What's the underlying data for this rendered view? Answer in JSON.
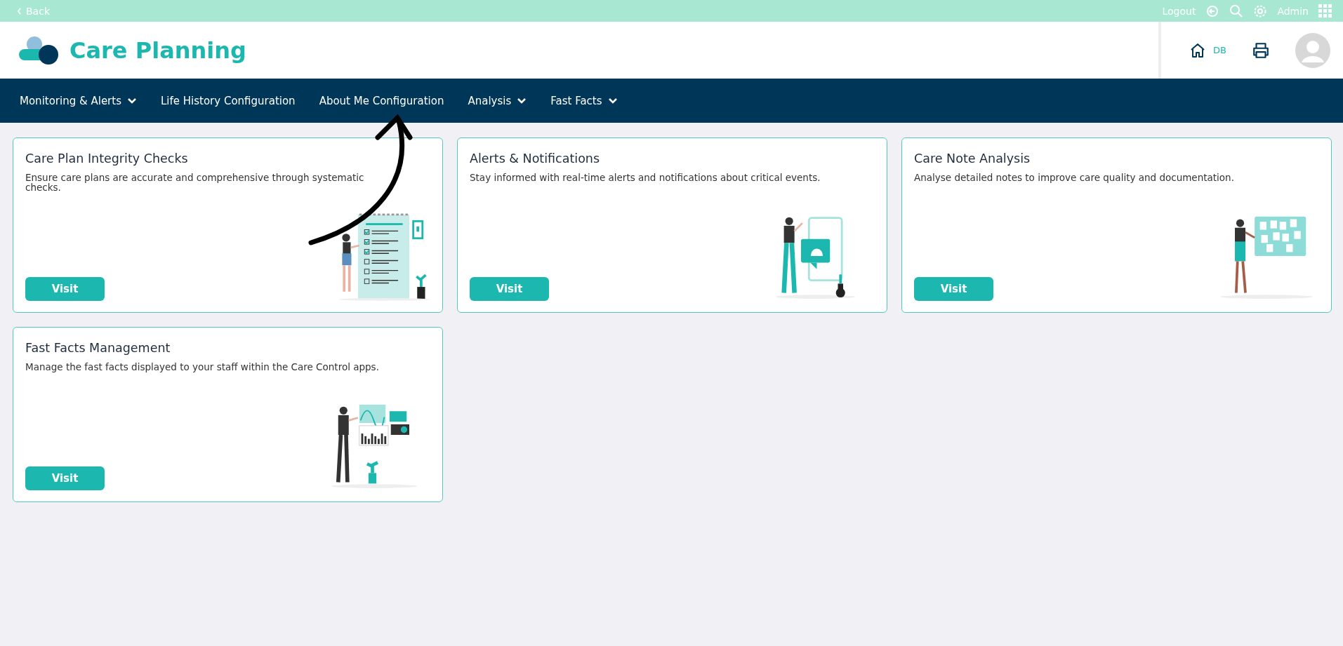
{
  "top_bar": {
    "back": "Back",
    "logout": "Logout",
    "user": "Admin"
  },
  "header": {
    "app_title": "Care Planning",
    "home_label": "DB"
  },
  "nav": [
    {
      "label": "Monitoring & Alerts",
      "dropdown": true
    },
    {
      "label": "Life History Configuration",
      "dropdown": false
    },
    {
      "label": "About Me Configuration",
      "dropdown": false
    },
    {
      "label": "Analysis",
      "dropdown": true
    },
    {
      "label": "Fast Facts",
      "dropdown": true
    }
  ],
  "cards": [
    {
      "title": "Care Plan Integrity Checks",
      "description": "Ensure care plans are accurate and comprehensive through systematic checks.",
      "button": "Visit",
      "kind": "checklist"
    },
    {
      "title": "Alerts & Notifications",
      "description": "Stay informed with real-time alerts and notifications about critical events.",
      "button": "Visit",
      "kind": "alerts"
    },
    {
      "title": "Care Note Analysis",
      "description": "Analyse detailed notes to improve care quality and documentation.",
      "button": "Visit",
      "kind": "board"
    },
    {
      "title": "Fast Facts Management",
      "description": "Manage the fast facts displayed to your staff within the Care Control apps.",
      "button": "Visit",
      "kind": "dashboard"
    }
  ]
}
